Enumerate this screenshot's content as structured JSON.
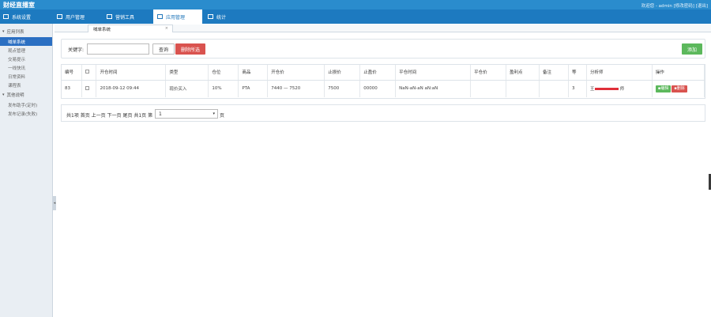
{
  "app": {
    "title": "财经直播室",
    "user_info": "欢迎您 - admin [修改密码] [退出]"
  },
  "nav": [
    {
      "label": "系统设置",
      "icon": "settings-icon",
      "active": false
    },
    {
      "label": "用户管理",
      "icon": "user-icon",
      "active": false
    },
    {
      "label": "营销工具",
      "icon": "toolbox-icon",
      "active": false
    },
    {
      "label": "应用管理",
      "icon": "list-icon",
      "active": true
    },
    {
      "label": "统计",
      "icon": "chart-icon",
      "active": false
    }
  ],
  "sidebar": {
    "groups": [
      {
        "label": "应用列表",
        "items": [
          "喊单系统",
          "观点管理",
          "交易提示",
          "一线快讯",
          "日常资料",
          "课程表"
        ]
      },
      {
        "label": "其他说明",
        "items": [
          "发布助手(定时)",
          "发布记录(失败)"
        ]
      }
    ],
    "active_item": "喊单系统"
  },
  "page_tab": {
    "label": "喊单系统",
    "close": "×"
  },
  "filter": {
    "keyword_label": "关键字:",
    "keyword_value": "",
    "query_label": "查询",
    "clear_label": "删除所选",
    "add_label": "添加"
  },
  "table": {
    "columns": [
      "编号",
      "",
      "开仓时间",
      "类型",
      "仓位",
      "商品",
      "开仓价",
      "止损价",
      "止盈价",
      "平仓时间",
      "平仓价",
      "盈利点",
      "备注",
      "等",
      "分析师",
      "操作"
    ],
    "rows": [
      {
        "id": "83",
        "open_time": "2018-09-12 09:44",
        "type": "现价买入",
        "position": "10%",
        "product": "PTA",
        "open_price": "7440 — 7520",
        "stop_loss": "7500",
        "take_profit": "00000",
        "close_time": "NaN-aN-aN aN:aN",
        "close_price": "",
        "profit": "",
        "note": "",
        "level": "3",
        "analyst_prefix": "王",
        "analyst_suffix": "师",
        "edit_label": "编辑",
        "delete_label": "删除"
      }
    ]
  },
  "pager": {
    "text": "共1项 首页 上一页 下一页 尾页 共1页  第",
    "page_value": "1",
    "suffix": "页"
  },
  "colors": {
    "topbar": "#2a8ccd",
    "navbar": "#1d7ac0",
    "sidebar_active": "#2b6fc2",
    "danger": "#d9534f",
    "success": "#5cb85c"
  }
}
